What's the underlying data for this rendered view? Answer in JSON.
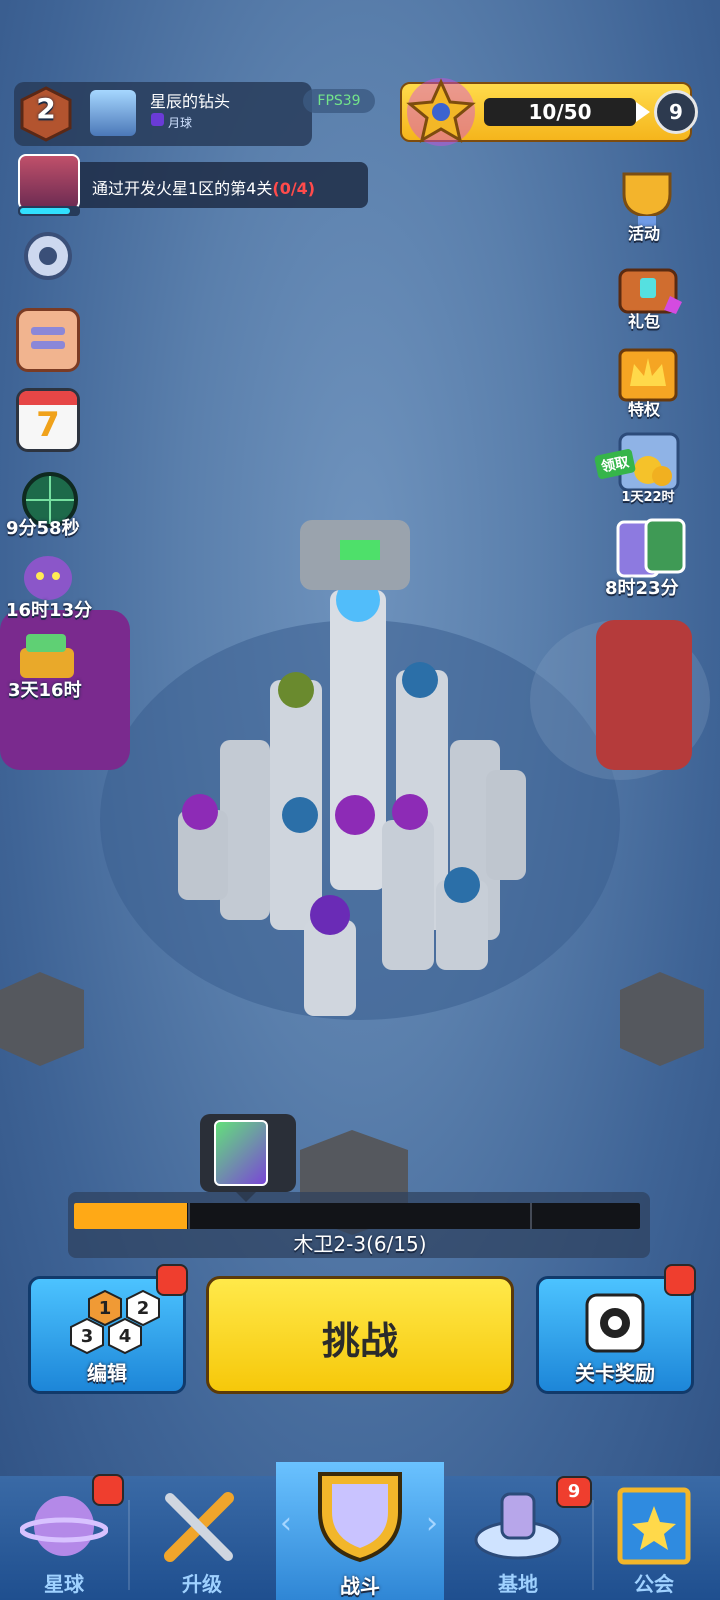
{
  "profile": {
    "level": "2",
    "name": "星辰的钻头",
    "location": "月球",
    "fps": "FPS39"
  },
  "xp": {
    "value": "10/50",
    "next_level": "9",
    "fraction": 0.2
  },
  "quest": {
    "text": "通过开发火星1区的第4关",
    "progress": "(0/4)"
  },
  "left_timers": {
    "radar": "9分58秒",
    "monster": "16时13分",
    "shop": "3天16时"
  },
  "calendar_day": "7",
  "right_menu": {
    "activity": "活动",
    "gift": "礼包",
    "privilege": "特权",
    "claim_badge": "领取",
    "claim_timer": "1天22时",
    "cards_timer": "8时23分"
  },
  "stage": {
    "label": "木卫2-3(6/15)",
    "progress_fraction": 0.2
  },
  "actions": {
    "edit": "编辑",
    "challenge": "挑战",
    "reward": "关卡奖励",
    "edit_tiles": [
      "1",
      "2",
      "3",
      "4"
    ]
  },
  "nav": {
    "planet": "星球",
    "upgrade": "升级",
    "battle": "战斗",
    "base": "基地",
    "guild": "公会",
    "base_badge": "9"
  },
  "colors": {
    "accent_yellow": "#f6c80a",
    "notif_red": "#ef3e2e",
    "progress_orange": "#ffa916"
  }
}
